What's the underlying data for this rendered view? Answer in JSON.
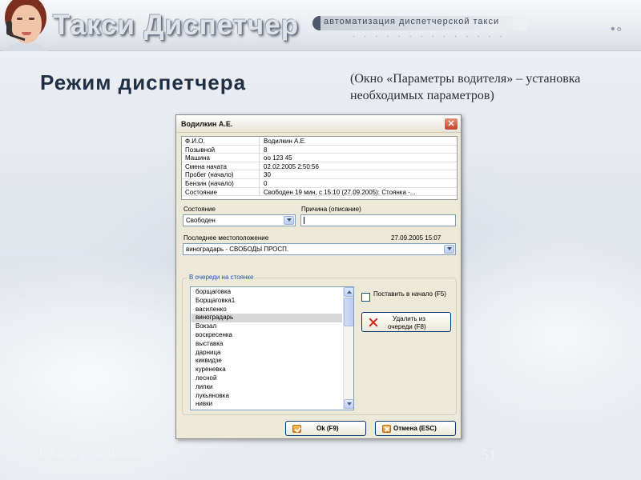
{
  "header": {
    "app_name": "Такси Диспетчер",
    "tagline": "автоматизация диспетчерской такси"
  },
  "slide": {
    "title": "Режим диспетчера",
    "caption": "(Окно «Параметры водителя» – установка необходимых параметров)",
    "footer_brand": "F-Group Software",
    "page_number": "51"
  },
  "dialog": {
    "title": "Водилкин А.Е.",
    "close_label": "✕",
    "properties": [
      {
        "key": "Ф.И.О.",
        "value": "Водилкин А.Е."
      },
      {
        "key": "Позывной",
        "value": "8"
      },
      {
        "key": "Машина",
        "value": "оо 123 45"
      },
      {
        "key": "Смена начата",
        "value": "02.02.2005 2:50:56"
      },
      {
        "key": "Пробег (начало)",
        "value": "30"
      },
      {
        "key": "Бензин (начало)",
        "value": "0"
      },
      {
        "key": "Состояние",
        "value": "Свободен 19 мин,   с 15:10 (27.09.2005): Стоянка -..."
      }
    ],
    "state": {
      "label": "Состояние",
      "value": "Свободен"
    },
    "reason": {
      "label": "Причина (описание)",
      "value": ""
    },
    "last_location": {
      "label": "Последнее местоположение",
      "timestamp": "27.09.2005 15:07",
      "value": "виноградарь - СВОБОДЫ ПРОСП."
    },
    "queue": {
      "legend": "В очереди на стоянке",
      "items": [
        "борщаговка",
        "Борщаговка1",
        "василенко",
        "виноградарь",
        "Вокзал",
        "воскресенка",
        "выставка",
        "дарница",
        "киквидзе",
        "куреневка",
        "лесной",
        "липки",
        "лукьяновка",
        "нивки"
      ],
      "selected_index": 3,
      "put_first_label": "Поставить в начало (F5)",
      "remove_label_line1": "Удалить из",
      "remove_label_line2": "очереди (F8)"
    },
    "ok_label": "Ok (F9)",
    "cancel_label": "Отмена (ESC)"
  }
}
